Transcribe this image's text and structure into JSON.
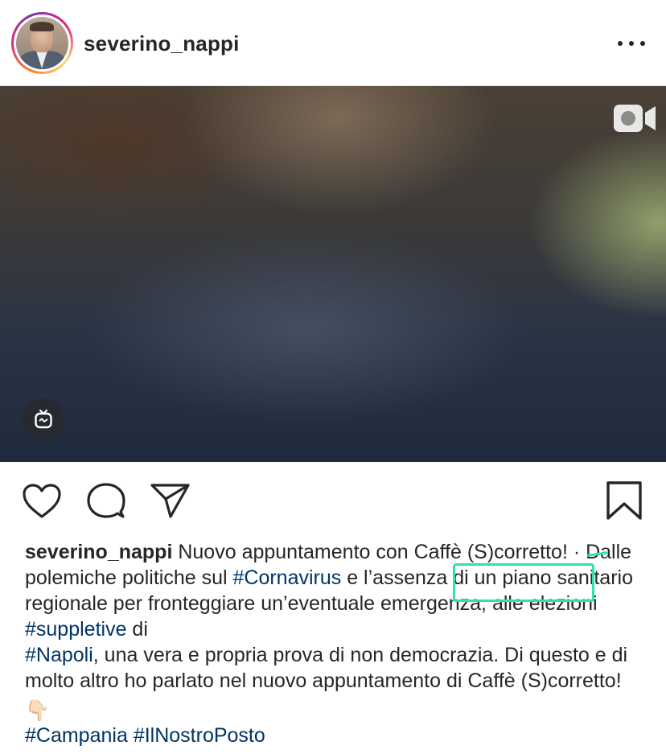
{
  "header": {
    "username": "severino_nappi",
    "more_icon": "more-horizontal-icon"
  },
  "media": {
    "video_icon": "video-camera-icon",
    "igtv_icon": "igtv-icon"
  },
  "actions": {
    "like_icon": "heart-icon",
    "comment_icon": "comment-icon",
    "share_icon": "paper-plane-icon",
    "save_icon": "bookmark-icon"
  },
  "caption": {
    "author": "severino_nappi",
    "part1": " Nuovo appuntamento con Caffè (S)corretto! · Dalle polemiche politiche sul ",
    "tag1": "#Cornavirus",
    "part2": " e l’assenza di un piano sanitario regionale per fronteggiare un’eventuale emergenza, alle elezioni ",
    "tag2": "#suppletive",
    "part3": " di ",
    "tag3": "#Napoli",
    "part4": ", una vera e propria prova di non democrazia. Di questo e di molto altro ho parlato nel nuovo appuntamento di Caffè (S)corretto! ",
    "emoji": "👇🏻",
    "tag4": "#Campania",
    "tag5": "#IlNostroPosto"
  },
  "colors": {
    "text": "#262626",
    "hashtag": "#003569",
    "highlight": "#2fe0b0"
  }
}
